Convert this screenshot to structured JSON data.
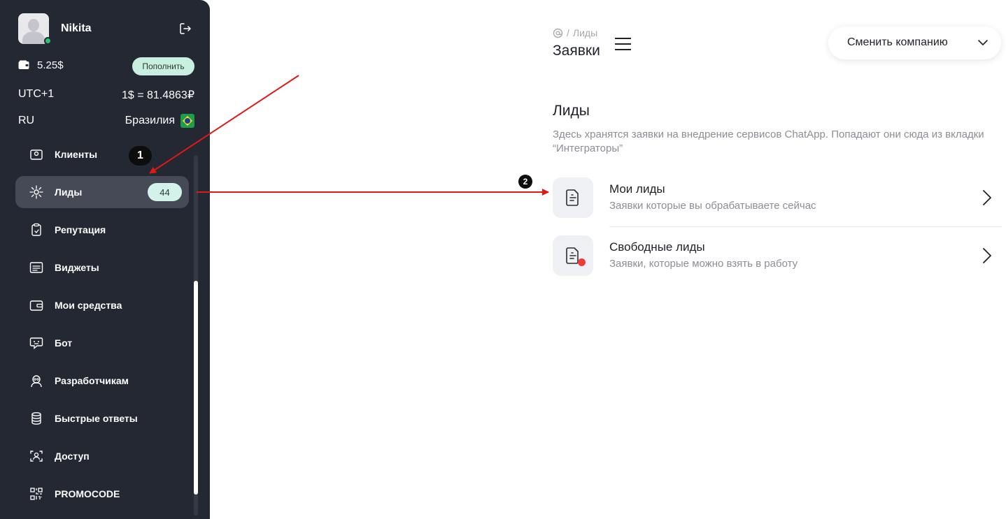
{
  "user": {
    "name": "Nikita"
  },
  "account": {
    "balance": "5.25$",
    "topup_label": "Пополнить",
    "timezone": "UTC+1",
    "rate": "1$ = 81.4863₽",
    "language": "RU",
    "country": "Бразилия"
  },
  "menu": {
    "items": [
      {
        "label": "Клиенты",
        "icon": "clients-icon"
      },
      {
        "label": "Лиды",
        "icon": "leads-icon",
        "badge": "44",
        "active": true
      },
      {
        "label": "Репутация",
        "icon": "clipboard-check-icon"
      },
      {
        "label": "Виджеты",
        "icon": "widget-icon"
      },
      {
        "label": "Мои средства",
        "icon": "wallet-icon"
      },
      {
        "label": "Бот",
        "icon": "bot-chat-icon"
      },
      {
        "label": "Разработчикам",
        "icon": "developer-icon"
      },
      {
        "label": "Быстрые ответы",
        "icon": "database-icon"
      },
      {
        "label": "Доступ",
        "icon": "access-icon"
      },
      {
        "label": "PROMOCODE",
        "icon": "qr-code-icon"
      }
    ]
  },
  "header": {
    "breadcrumb_current": "Лиды",
    "breadcrumb_sep": "/",
    "title": "Заявки",
    "company_select": "Сменить компанию"
  },
  "section": {
    "title": "Лиды",
    "description": "Здесь хранятся заявки на внедрение сервисов ChatApp. Попадают они сюда из вкладки “Интеграторы”"
  },
  "leads": [
    {
      "title": "Мои лиды",
      "subtitle": "Заявки которые вы обрабатываете сейчас"
    },
    {
      "title": "Свободные лиды",
      "subtitle": "Заявки, которые можно взять в работу"
    }
  ],
  "annotations": {
    "step1": "1",
    "step2": "2",
    "arrow_color": "#e01818"
  },
  "colors": {
    "sidebar": "#242833",
    "accent_badge": "#d3f2ea",
    "online": "#28c76f",
    "alert_dot": "#ee3b3b"
  }
}
